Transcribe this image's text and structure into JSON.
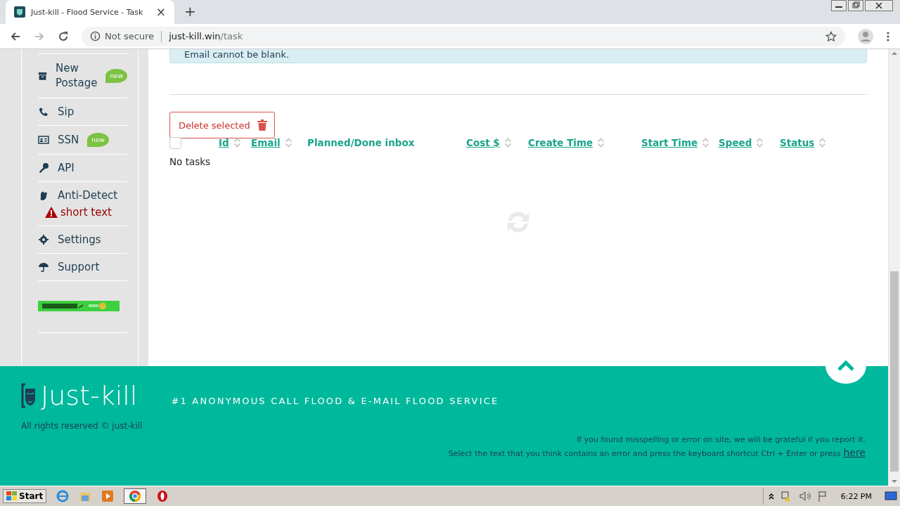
{
  "browser": {
    "tab_title": "Just-kill - Flood Service - Task",
    "tab_close": "×",
    "new_tab": "+",
    "security": "Not secure",
    "url_host": "just-kill.win",
    "url_path": "/task"
  },
  "sidebar": {
    "items": [
      {
        "label": "New Postage",
        "badge": "new"
      },
      {
        "label": "Sip"
      },
      {
        "label": "SSN",
        "badge": "new"
      },
      {
        "label": "API"
      },
      {
        "label": "Anti-Detect",
        "warning": "short text"
      },
      {
        "label": "Settings"
      },
      {
        "label": "Support"
      }
    ]
  },
  "alert": "Email cannot be blank.",
  "delete_button": "Delete selected",
  "table": {
    "select_all_checked": false,
    "columns": [
      {
        "label": "Id",
        "sortable": true
      },
      {
        "label": "Email",
        "sortable": true
      },
      {
        "label": "Planned/Done inbox",
        "sortable": false
      },
      {
        "label": "Cost $",
        "sortable": true
      },
      {
        "label": "Create Time",
        "sortable": true
      },
      {
        "label": "Start Time",
        "sortable": true
      },
      {
        "label": "Speed",
        "sortable": true
      },
      {
        "label": "Status",
        "sortable": true
      }
    ],
    "empty_text": "No tasks"
  },
  "footer": {
    "logo": "Just-kill",
    "tagline": "#1 ANONYMOUS CALL FLOOD & E-MAIL FLOOD SERVICE",
    "copyright": "All rights reserved © just-kill",
    "report_line_1": "If you found misspelling or error on site, we will be grateful if you report it.",
    "report_line_2": "Select the text that you think contains an error and press the keyboard shortcut Ctrl + Enter or press",
    "report_link": "here"
  },
  "taskbar": {
    "start": "Start",
    "clock": "6:22 PM"
  }
}
